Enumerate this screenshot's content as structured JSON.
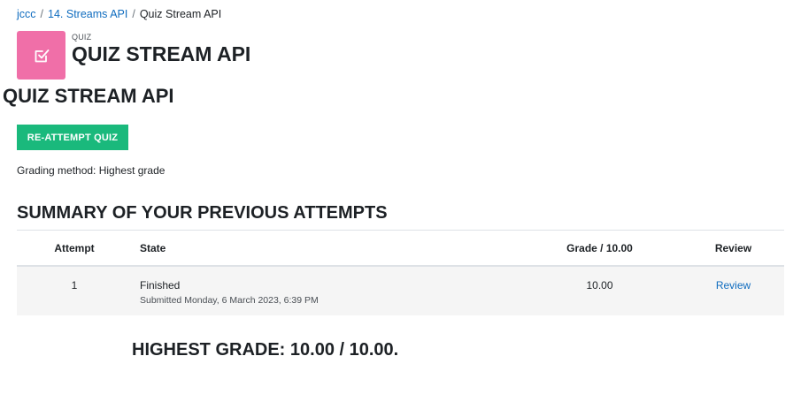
{
  "breadcrumb": {
    "items": [
      "jccc",
      "14. Streams API"
    ],
    "separator": "/",
    "current": "Quiz Stream API"
  },
  "header": {
    "icon": "quiz-checkbox-icon",
    "icon_color": "#f06fa8",
    "activity_type": "QUIZ",
    "title": "QUIZ STREAM API"
  },
  "page": {
    "title": "QUIZ STREAM API"
  },
  "actions": {
    "reattempt_label": "RE-ATTEMPT QUIZ",
    "reattempt_color": "#1ab97c"
  },
  "grading_method": "Grading method: Highest grade",
  "summary": {
    "heading": "SUMMARY OF YOUR PREVIOUS ATTEMPTS",
    "columns": {
      "attempt": "Attempt",
      "state": "State",
      "grade": "Grade / 10.00",
      "review": "Review"
    },
    "rows": [
      {
        "attempt": "1",
        "state": "Finished",
        "submitted": "Submitted Monday, 6 March 2023, 6:39 PM",
        "grade": "10.00",
        "review": "Review"
      }
    ]
  },
  "highest_grade": "HIGHEST GRADE: 10.00 / 10.00."
}
